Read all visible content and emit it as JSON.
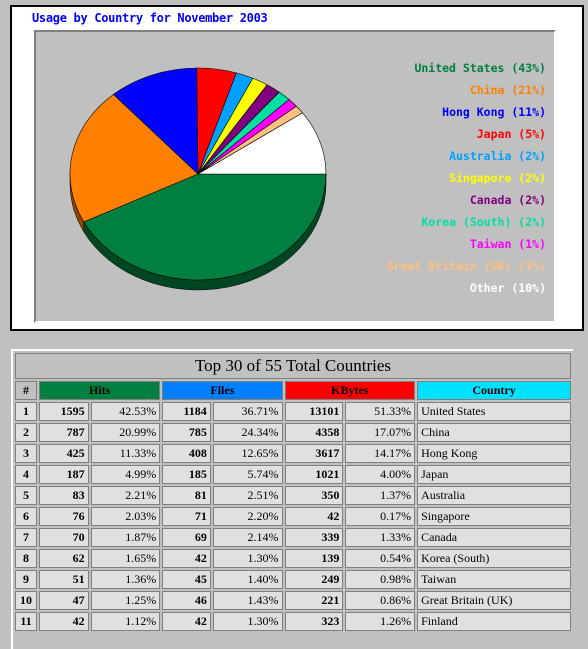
{
  "chart_data": {
    "type": "pie",
    "title": "Usage by Country for November 2003",
    "slices": [
      {
        "label": "United States (43%)",
        "value": 42.53,
        "color": "#008040"
      },
      {
        "label": "China (21%)",
        "value": 20.99,
        "color": "#ff8000"
      },
      {
        "label": "Hong Kong (11%)",
        "value": 11.33,
        "color": "#0000ff"
      },
      {
        "label": "Japan (5%)",
        "value": 4.99,
        "color": "#ff0000"
      },
      {
        "label": "Australia (2%)",
        "value": 2.21,
        "color": "#00a0ff"
      },
      {
        "label": "Singapore (2%)",
        "value": 2.03,
        "color": "#ffff00"
      },
      {
        "label": "Canada (2%)",
        "value": 1.87,
        "color": "#800080"
      },
      {
        "label": "Korea (South) (2%)",
        "value": 1.65,
        "color": "#00e0a0"
      },
      {
        "label": "Taiwan (1%)",
        "value": 1.36,
        "color": "#ff00ff"
      },
      {
        "label": "Great Britain (UK) (1%)",
        "value": 1.25,
        "color": "#ffc080"
      },
      {
        "label": "Other (10%)",
        "value": 9.79,
        "color": "#ffffff"
      }
    ]
  },
  "table": {
    "title": "Top 30 of 55 Total Countries",
    "headers": [
      "#",
      "Hits",
      "Files",
      "KBytes",
      "Country"
    ],
    "header_colors": {
      "hits": "#008040",
      "files": "#0080ff",
      "kbytes": "#ff0000",
      "country": "#00e0ff"
    },
    "rows": [
      {
        "rank": "1",
        "hits": "1595",
        "hits_pct": "42.53%",
        "files": "1184",
        "files_pct": "36.71%",
        "kbytes": "13101",
        "kbytes_pct": "51.33%",
        "country": "United States"
      },
      {
        "rank": "2",
        "hits": "787",
        "hits_pct": "20.99%",
        "files": "785",
        "files_pct": "24.34%",
        "kbytes": "4358",
        "kbytes_pct": "17.07%",
        "country": "China"
      },
      {
        "rank": "3",
        "hits": "425",
        "hits_pct": "11.33%",
        "files": "408",
        "files_pct": "12.65%",
        "kbytes": "3617",
        "kbytes_pct": "14.17%",
        "country": "Hong Kong"
      },
      {
        "rank": "4",
        "hits": "187",
        "hits_pct": "4.99%",
        "files": "185",
        "files_pct": "5.74%",
        "kbytes": "1021",
        "kbytes_pct": "4.00%",
        "country": "Japan"
      },
      {
        "rank": "5",
        "hits": "83",
        "hits_pct": "2.21%",
        "files": "81",
        "files_pct": "2.51%",
        "kbytes": "350",
        "kbytes_pct": "1.37%",
        "country": "Australia"
      },
      {
        "rank": "6",
        "hits": "76",
        "hits_pct": "2.03%",
        "files": "71",
        "files_pct": "2.20%",
        "kbytes": "42",
        "kbytes_pct": "0.17%",
        "country": "Singapore"
      },
      {
        "rank": "7",
        "hits": "70",
        "hits_pct": "1.87%",
        "files": "69",
        "files_pct": "2.14%",
        "kbytes": "339",
        "kbytes_pct": "1.33%",
        "country": "Canada"
      },
      {
        "rank": "8",
        "hits": "62",
        "hits_pct": "1.65%",
        "files": "42",
        "files_pct": "1.30%",
        "kbytes": "139",
        "kbytes_pct": "0.54%",
        "country": "Korea (South)"
      },
      {
        "rank": "9",
        "hits": "51",
        "hits_pct": "1.36%",
        "files": "45",
        "files_pct": "1.40%",
        "kbytes": "249",
        "kbytes_pct": "0.98%",
        "country": "Taiwan"
      },
      {
        "rank": "10",
        "hits": "47",
        "hits_pct": "1.25%",
        "files": "46",
        "files_pct": "1.43%",
        "kbytes": "221",
        "kbytes_pct": "0.86%",
        "country": "Great Britain (UK)"
      },
      {
        "rank": "11",
        "hits": "42",
        "hits_pct": "1.12%",
        "files": "42",
        "files_pct": "1.30%",
        "kbytes": "323",
        "kbytes_pct": "1.26%",
        "country": "Finland"
      }
    ]
  }
}
